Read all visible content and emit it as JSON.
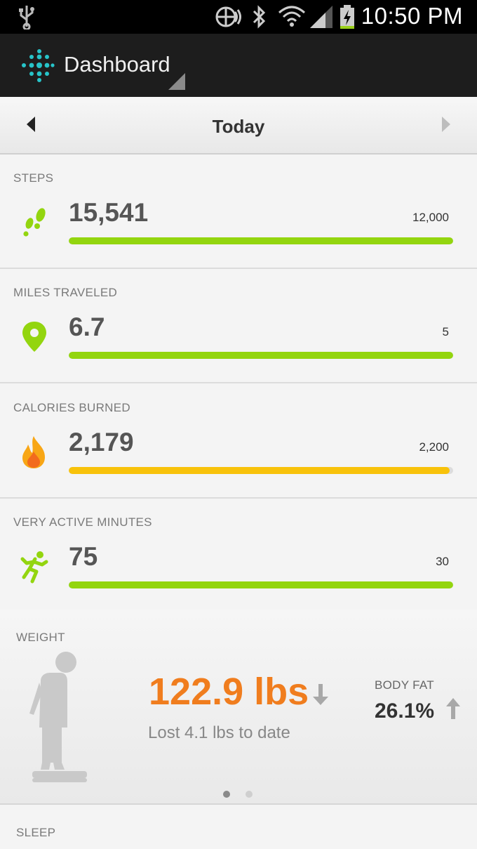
{
  "status_bar": {
    "time": "10:50 PM",
    "icons": [
      "usb-icon",
      "nfc-icon",
      "bluetooth-icon",
      "wifi-icon",
      "cell-signal-icon",
      "battery-charging-icon"
    ]
  },
  "action_bar": {
    "title": "Dashboard",
    "logo": "fitbit-logo-icon"
  },
  "date_nav": {
    "label": "Today"
  },
  "metrics": [
    {
      "label": "STEPS",
      "value": "15,541",
      "goal": "12,000",
      "progress": 1.0,
      "color": "#93d50f",
      "icon": "footsteps-icon"
    },
    {
      "label": "MILES TRAVELED",
      "value": "6.7",
      "goal": "5",
      "progress": 1.0,
      "color": "#93d50f",
      "icon": "location-pin-icon"
    },
    {
      "label": "CALORIES BURNED",
      "value": "2,179",
      "goal": "2,200",
      "progress": 0.99,
      "color": "#f8c20a",
      "icon": "flame-icon"
    },
    {
      "label": "VERY ACTIVE MINUTES",
      "value": "75",
      "goal": "30",
      "progress": 1.0,
      "color": "#93d50f",
      "icon": "running-person-icon"
    }
  ],
  "weight": {
    "label": "WEIGHT",
    "value": "122.9 lbs",
    "subtitle": "Lost 4.1 lbs to date",
    "body_fat_label": "BODY FAT",
    "body_fat_value": "26.1%",
    "weight_color": "#f07d1e",
    "page_indicator": {
      "count": 2,
      "active": 0
    }
  },
  "sleep": {
    "label": "SLEEP"
  }
}
